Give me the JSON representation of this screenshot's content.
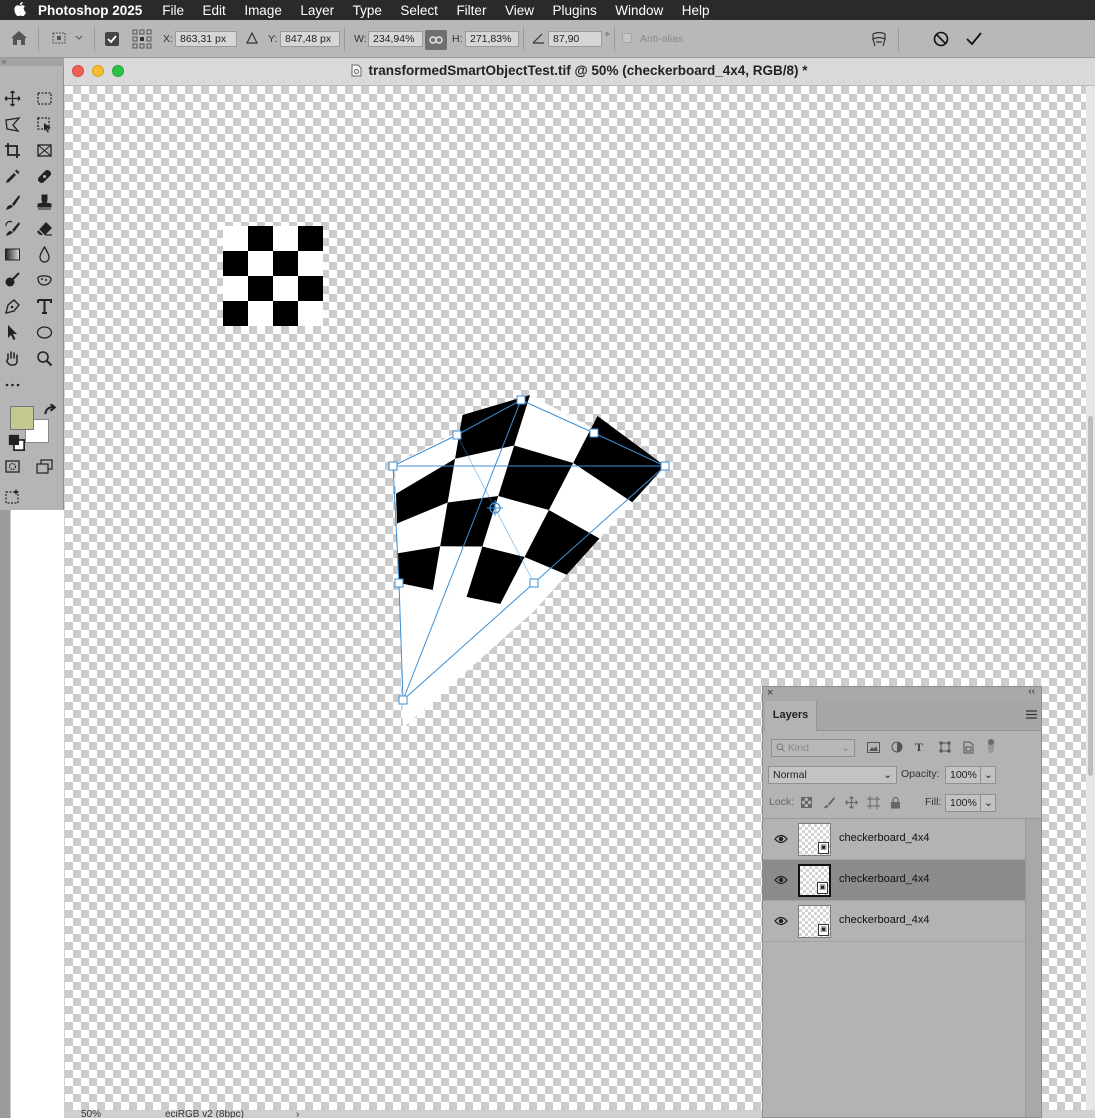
{
  "menubar": {
    "app_name": "Photoshop 2025",
    "items": [
      "File",
      "Edit",
      "Image",
      "Layer",
      "Type",
      "Select",
      "Filter",
      "View",
      "Plugins",
      "Window",
      "Help"
    ]
  },
  "options": {
    "x_label": "X:",
    "x_value": "863,31 px",
    "y_label": "Y:",
    "y_value": "847,48 px",
    "w_label": "W:",
    "w_value": "234,94%",
    "h_label": "H:",
    "h_value": "271,83%",
    "angle_value": "87,90",
    "degree": "°",
    "antialias_label": "Anti-alias"
  },
  "document": {
    "title": "transformedSmartObjectTest.tif @ 50% (checkerboard_4x4, RGB/8) *",
    "zoom": "50%",
    "color_profile": "eciRGB v2 (8bpc)"
  },
  "colors": {
    "foreground": "#c3c98f",
    "background": "#ffffff",
    "transform_handles": "#3d8fd6"
  },
  "layers_panel": {
    "tab": "Layers",
    "kind_placeholder": "Kind",
    "blend_mode": "Normal",
    "opacity_label": "Opacity:",
    "opacity_value": "100%",
    "lock_label": "Lock:",
    "fill_label": "Fill:",
    "fill_value": "100%",
    "layers": [
      {
        "name": "checkerboard_4x4",
        "selected": false
      },
      {
        "name": "checkerboard_4x4",
        "selected": true
      },
      {
        "name": "checkerboard_4x4",
        "selected": false
      }
    ]
  },
  "icons": {
    "tools": [
      "move-icon",
      "marquee-icon",
      "lasso-icon",
      "object-select-icon",
      "crop-icon",
      "frame-icon",
      "eyedropper-icon",
      "healing-icon",
      "brush-icon",
      "stamp-icon",
      "history-brush-icon",
      "eraser-icon",
      "gradient-icon",
      "blur-icon",
      "dodge-icon",
      "sponge-icon",
      "pen-icon",
      "type-icon",
      "path-select-icon",
      "ellipse-icon",
      "hand-icon",
      "zoom-icon",
      "more-tools-icon"
    ]
  }
}
